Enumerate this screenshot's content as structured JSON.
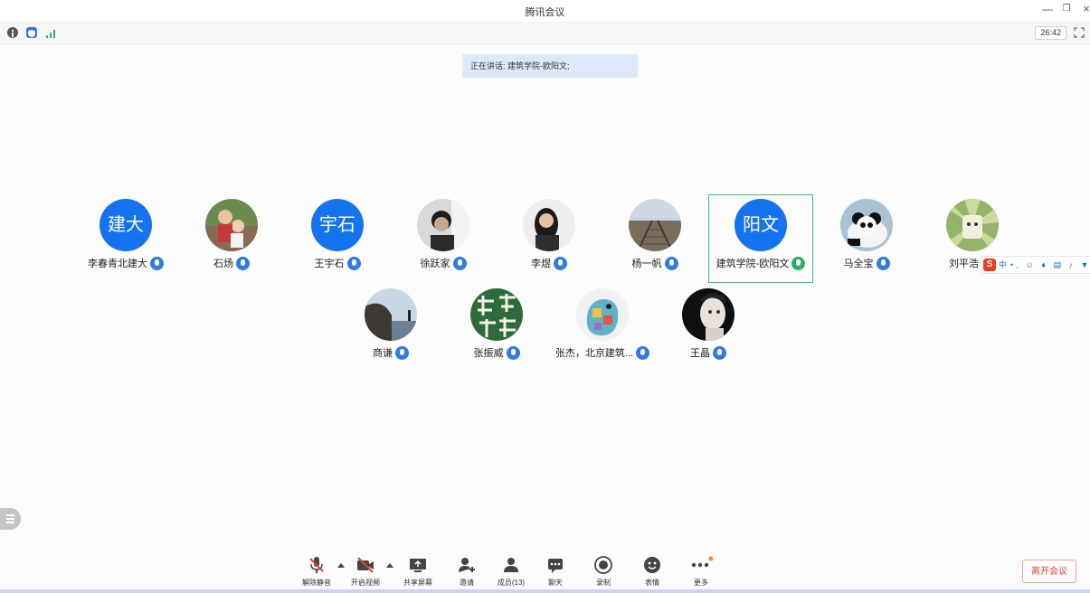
{
  "app": {
    "title": "腾讯会议"
  },
  "window": {
    "minimize_glyph": "—",
    "restore_glyph": "❐",
    "close_glyph": "×"
  },
  "info": {
    "timer": "26:42"
  },
  "speaking": {
    "text": "正在讲话: 建筑学院-欧阳文;"
  },
  "participants": [
    {
      "name": "李春青北建大",
      "avatar_text": "建大",
      "mic": "blue"
    },
    {
      "name": "石炀",
      "avatar_icon": "family-photo-icon",
      "mic": "blue"
    },
    {
      "name": "王宇石",
      "avatar_text": "宇石",
      "mic": "blue"
    },
    {
      "name": "徐跃家",
      "avatar_icon": "man-photo-icon",
      "mic": "blue"
    },
    {
      "name": "李煜",
      "avatar_icon": "woman-photo-icon",
      "mic": "blue"
    },
    {
      "name": "杨一帆",
      "avatar_icon": "railway-photo-icon",
      "mic": "blue"
    },
    {
      "name": "建筑学院-欧阳文",
      "avatar_text": "阳文",
      "mic": "green",
      "active": true
    },
    {
      "name": "马全宝",
      "avatar_icon": "panda-photo-icon",
      "mic": "blue"
    },
    {
      "name": "刘平浩",
      "avatar_icon": "cartoon-avatar-icon",
      "mic": "blue"
    },
    {
      "name": "商谦",
      "avatar_icon": "cliff-photo-icon",
      "mic": "blue"
    },
    {
      "name": "张振威",
      "avatar_icon": "calligraphy-avatar-icon",
      "mic": "blue"
    },
    {
      "name": "张杰，北京建筑...",
      "avatar_icon": "colorful-cat-icon",
      "mic": "blue"
    },
    {
      "name": "王晶",
      "avatar_icon": "woman-portrait-icon",
      "mic": "blue"
    }
  ],
  "ime": {
    "logo": "S",
    "mode": "中"
  },
  "toolbar": {
    "unmute": "解除静音",
    "video": "开启视频",
    "share": "共享屏幕",
    "invite": "邀请",
    "members": "成员(13)",
    "chat": "聊天",
    "record": "录制",
    "reaction": "表情",
    "more": "更多",
    "leave": "离开会议"
  },
  "colors": {
    "accent": "#1573ef",
    "active_border": "#3cc27a",
    "leave": "#e0432d",
    "speaking_bg": "#dbe9fb"
  }
}
